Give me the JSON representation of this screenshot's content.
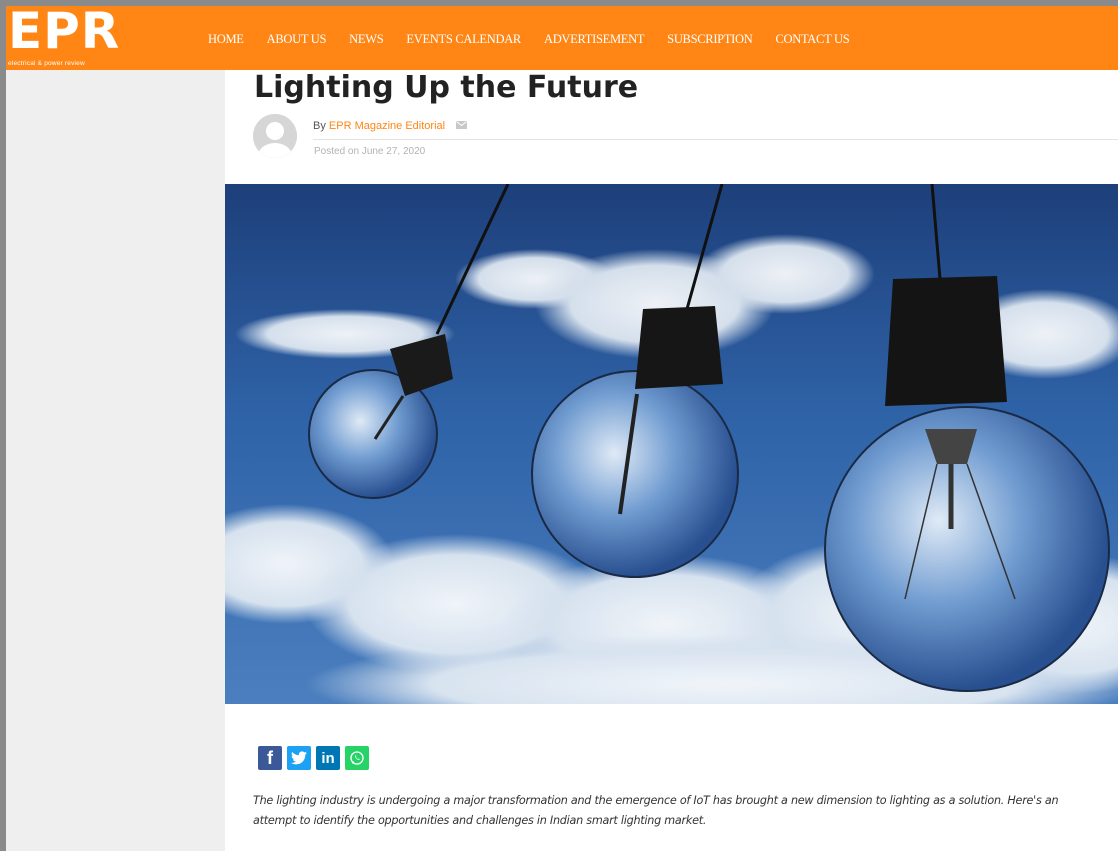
{
  "brand": {
    "logo_text": "EPR",
    "logo_tagline": "electrical & power review",
    "accent_color": "#ff8614"
  },
  "nav": {
    "items": [
      "HOME",
      "ABOUT US",
      "NEWS",
      "EVENTS CALENDAR",
      "ADVERTISEMENT",
      "SUBSCRIPTION",
      "CONTACT US"
    ]
  },
  "article": {
    "title": "Lighting Up the Future",
    "by_prefix": "By",
    "author": "EPR Magazine Editorial",
    "posted": "Posted on June 27, 2020",
    "excerpt": "The lighting industry is undergoing a major transformation and the emergence of IoT has brought a new dimension to lighting as a solution. Here's an attempt to identify the opportunities and challenges in Indian smart lighting market."
  },
  "share": {
    "buttons": [
      {
        "icon": "facebook-icon",
        "glyph": "f",
        "color": "#3b5998"
      },
      {
        "icon": "twitter-icon",
        "glyph": "",
        "color": "#1da1f2"
      },
      {
        "icon": "linkedin-icon",
        "glyph": "in",
        "color": "#0077b5"
      },
      {
        "icon": "whatsapp-icon",
        "glyph": "",
        "color": "#25d366"
      }
    ]
  }
}
